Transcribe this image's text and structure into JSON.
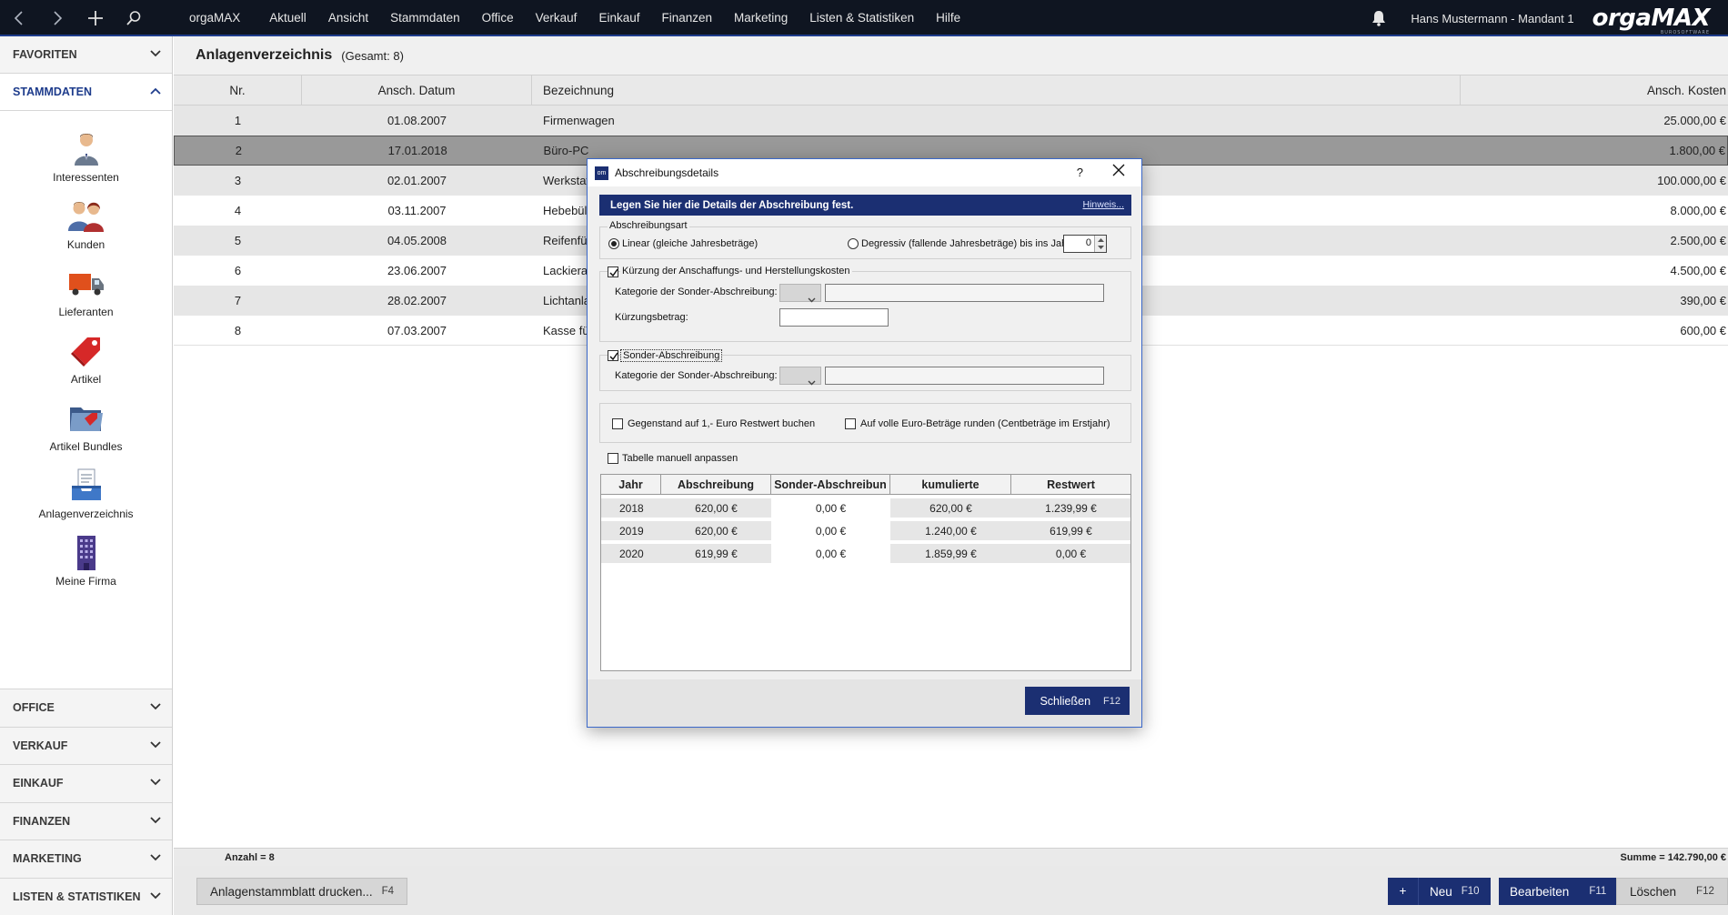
{
  "topbar": {
    "brand": "orgaMAX",
    "menu": [
      "Aktuell",
      "Ansicht",
      "Stammdaten",
      "Office",
      "Verkauf",
      "Einkauf",
      "Finanzen",
      "Marketing",
      "Listen & Statistiken",
      "Hilfe"
    ],
    "user": "Hans Mustermann - Mandant 1",
    "logo": "orgaMAX",
    "logo_sub": "BUROSOFTWARE"
  },
  "sidebar": {
    "favoriten": "FAVORITEN",
    "stammdaten": "STAMMDATEN",
    "items": [
      {
        "label": "Interessenten",
        "icon": "person-icon"
      },
      {
        "label": "Kunden",
        "icon": "customers-icon"
      },
      {
        "label": "Lieferanten",
        "icon": "truck-icon"
      },
      {
        "label": "Artikel",
        "icon": "tag-icon"
      },
      {
        "label": "Artikel Bundles",
        "icon": "folder-tag-icon"
      },
      {
        "label": "Anlagenverzeichnis",
        "icon": "inbox-icon"
      },
      {
        "label": "Meine Firma",
        "icon": "building-icon"
      }
    ],
    "bottom": [
      "OFFICE",
      "VERKAUF",
      "EINKAUF",
      "FINANZEN",
      "MARKETING",
      "LISTEN & STATISTIKEN"
    ]
  },
  "main": {
    "title": "Anlagenverzeichnis",
    "count": "(Gesamt: 8)",
    "columns": [
      "Nr.",
      "Ansch. Datum",
      "Bezeichnung",
      "Ansch. Kosten"
    ],
    "rows": [
      {
        "nr": "1",
        "datum": "01.08.2007",
        "bez": "Firmenwagen",
        "kosten": "25.000,00 €"
      },
      {
        "nr": "2",
        "datum": "17.01.2018",
        "bez": "Büro-PC",
        "kosten": "1.800,00 €"
      },
      {
        "nr": "3",
        "datum": "02.01.2007",
        "bez": "Werkstat",
        "kosten": "100.000,00 €"
      },
      {
        "nr": "4",
        "datum": "03.11.2007",
        "bez": "Hebebül",
        "kosten": "8.000,00 €"
      },
      {
        "nr": "5",
        "datum": "04.05.2008",
        "bez": "Reifenfül",
        "kosten": "2.500,00 €"
      },
      {
        "nr": "6",
        "datum": "23.06.2007",
        "bez": "Lackiera",
        "kosten": "4.500,00 €"
      },
      {
        "nr": "7",
        "datum": "28.02.2007",
        "bez": "Lichtanla",
        "kosten": "390,00 €"
      },
      {
        "nr": "8",
        "datum": "07.03.2007",
        "bez": "Kasse fü",
        "kosten": "600,00 €"
      }
    ],
    "status_left": "Anzahl = 8",
    "status_right": "Summe = 142.790,00 €"
  },
  "actions": {
    "print": "Anlagenstammblatt  drucken...",
    "print_key": "F4",
    "new_plus": "+",
    "new": "Neu",
    "new_key": "F10",
    "edit": "Bearbeiten",
    "edit_key": "F11",
    "delete": "Löschen",
    "delete_key": "F12"
  },
  "dialog": {
    "title": "Abschreibungsdetails",
    "help": "?",
    "banner": "Legen Sie hier die Details der Abschreibung fest.",
    "hint": "Hinweis...",
    "art_group": "Abschreibungsart",
    "linear": "Linear (gleiche Jahresbeträge)",
    "degressiv": "Degressiv (fallende Jahresbeträge) bis ins Jahr:",
    "degressiv_year": "0",
    "kuerzung": "Kürzung der Anschaffungs- und Herstellungskosten",
    "kat1": "Kategorie der Sonder-Abschreibung:",
    "kuerzungsbetrag": "Kürzungsbetrag:",
    "sonder": "Sonder-Abschreibung",
    "kat2": "Kategorie der Sonder-Abschreibung:",
    "restwert": "Gegenstand auf 1,- Euro Restwert buchen",
    "runden": "Auf volle Euro-Beträge runden (Centbeträge im Erstjahr)",
    "manuell": "Tabelle manuell anpassen",
    "table_cols": [
      "Jahr",
      "Abschreibung",
      "Sonder-Abschreibun",
      "kumulierte",
      "Restwert"
    ],
    "table_rows": [
      {
        "jahr": "2018",
        "ab": "620,00 €",
        "sonder": "0,00 €",
        "kum": "620,00 €",
        "rest": "1.239,99 €"
      },
      {
        "jahr": "2019",
        "ab": "620,00 €",
        "sonder": "0,00 €",
        "kum": "1.240,00 €",
        "rest": "619,99 €"
      },
      {
        "jahr": "2020",
        "ab": "619,99 €",
        "sonder": "0,00 €",
        "kum": "1.859,99 €",
        "rest": "0,00 €"
      }
    ],
    "close": "Schließen",
    "close_key": "F12"
  }
}
